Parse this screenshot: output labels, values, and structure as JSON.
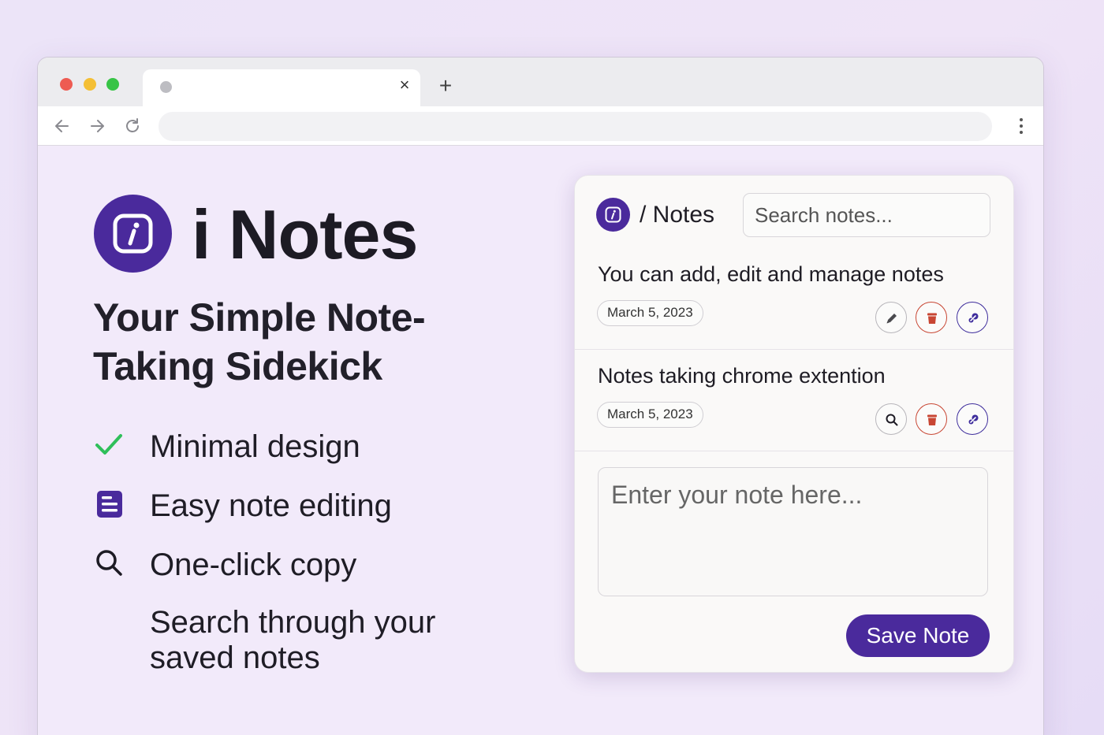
{
  "browser": {
    "new_tab_symbol": "+",
    "close_tab_symbol": "×"
  },
  "hero": {
    "brand": "i Notes",
    "tagline": "Your Simple Note-Taking Sidekick",
    "features": [
      {
        "icon": "checkmark-icon",
        "label": "Minimal design"
      },
      {
        "icon": "document-list-icon",
        "label": "Easy note editing"
      },
      {
        "icon": "magnifier-icon",
        "label": "One-click copy"
      },
      {
        "icon": "",
        "label": "Search through your saved notes"
      }
    ]
  },
  "popup": {
    "title": "/ Notes",
    "search_placeholder": "Search notes...",
    "notes": [
      {
        "text": "You can add, edit and manage notes",
        "date": "March 5, 2023",
        "first_action_icon": "pencil-icon"
      },
      {
        "text": "Notes taking chrome extention",
        "date": "March 5, 2023",
        "first_action_icon": "search-icon"
      }
    ],
    "editor_placeholder": "Enter your note here...",
    "save_label": "Save Note"
  },
  "colors": {
    "brand_purple": "#4a2a9c",
    "delete_red": "#c84633",
    "check_green": "#2fbf5a"
  }
}
